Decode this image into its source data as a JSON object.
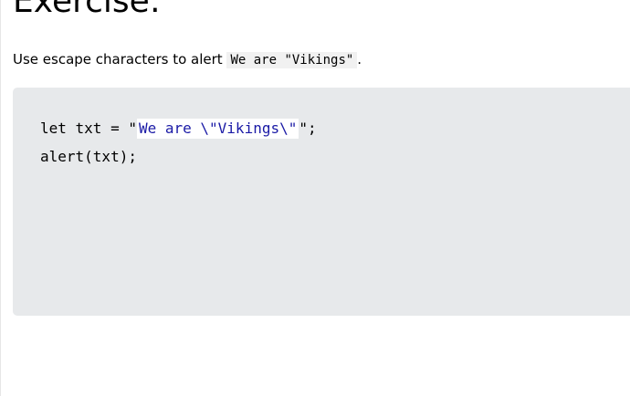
{
  "exercise": {
    "heading": "Exercise:",
    "instruction_prefix": "Use escape characters to alert ",
    "instruction_code": "We are \"Vikings\"",
    "instruction_suffix": "."
  },
  "code": {
    "line1_before": "let txt = \"",
    "answer_value": "We are \\\"Vikings\\\"",
    "line1_after": "\";",
    "line2": "alert(txt);"
  },
  "colors": {
    "code_background": "#e7e9eb",
    "answer_text": "#1a1aa6",
    "answer_background": "#ffffff"
  }
}
